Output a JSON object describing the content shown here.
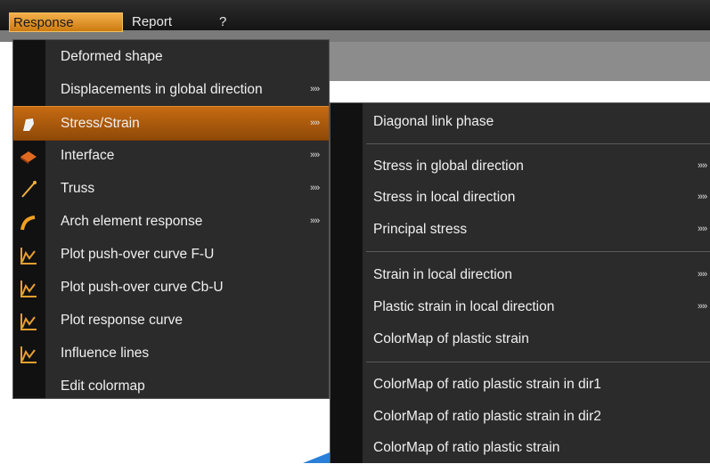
{
  "menubar": {
    "items": [
      {
        "label": "Response"
      },
      {
        "label": "Report"
      },
      {
        "label": "?"
      }
    ]
  },
  "response_menu": {
    "items": [
      {
        "label": "Deformed shape"
      },
      {
        "label": "Displacements in global direction",
        "submenu_marker": "»»"
      },
      {
        "label": "Stress/Strain",
        "submenu_marker": "»»"
      },
      {
        "label": "Interface",
        "submenu_marker": "»»"
      },
      {
        "label": "Truss",
        "submenu_marker": "»»"
      },
      {
        "label": "Arch element response",
        "submenu_marker": "»»"
      },
      {
        "label": "Plot push-over curve F-U"
      },
      {
        "label": "Plot push-over curve Cb-U"
      },
      {
        "label": "Plot response curve"
      },
      {
        "label": "Influence lines"
      },
      {
        "label": "Edit colormap"
      }
    ]
  },
  "stress_strain_submenu": {
    "items": [
      {
        "label": "Diagonal link phase"
      },
      {
        "label": "Stress in global direction",
        "submenu_marker": "»»"
      },
      {
        "label": "Stress in local direction",
        "submenu_marker": "»»"
      },
      {
        "label": "Principal stress",
        "submenu_marker": "»»"
      },
      {
        "label": "Strain in local direction",
        "submenu_marker": "»»"
      },
      {
        "label": "Plastic strain in local direction",
        "submenu_marker": "»»"
      },
      {
        "label": "ColorMap of plastic strain"
      },
      {
        "label": "ColorMap of ratio plastic strain in dir1"
      },
      {
        "label": "ColorMap of ratio plastic strain in dir2"
      },
      {
        "label": "ColorMap of ratio plastic strain"
      }
    ]
  },
  "colors": {
    "highlight": "#c56a12",
    "menu_bg": "#2b2b2b",
    "gutter": "#111111",
    "icon_orange": "#e8a030"
  }
}
